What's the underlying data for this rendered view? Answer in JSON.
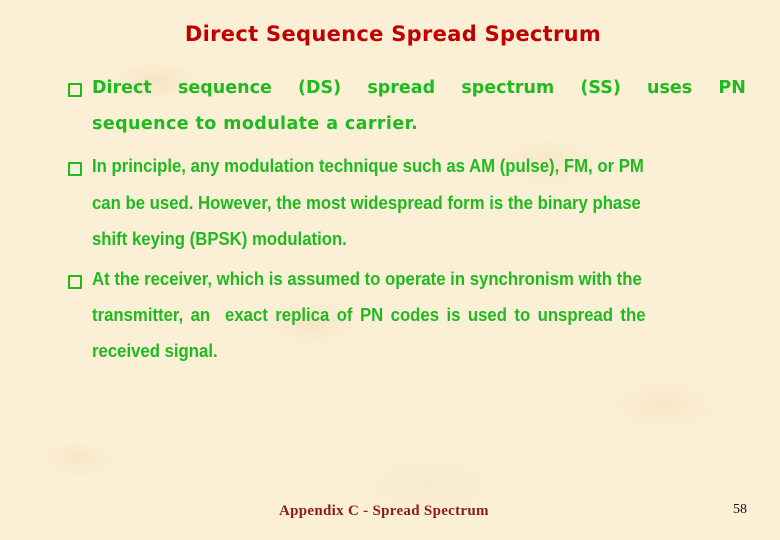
{
  "slide": {
    "title": "Direct Sequence Spread Spectrum",
    "bullets": [
      {
        "icon": "hollow-square-bullet",
        "line1_words": [
          "Direct",
          "sequence",
          "(DS)",
          "spread",
          "spectrum",
          "(SS)",
          "uses",
          "PN"
        ],
        "line2": "sequence to modulate a carrier."
      },
      {
        "icon": "hollow-square-bullet",
        "line1": "In principle, any modulation technique such as AM (pulse), FM, or PM",
        "line2": "can be used. However, the most widespread form is the binary phase",
        "line3": "shift keying (BPSK) modulation."
      },
      {
        "icon": "hollow-square-bullet",
        "line1": "At the receiver, which is assumed to operate in synchronism with the",
        "line2": "transmitter, an  exact replica of PN codes is used to unspread the",
        "line3": "received signal."
      }
    ],
    "footer": "Appendix C - Spread Spectrum",
    "page_number": "58"
  },
  "colors": {
    "title": "#c00000",
    "body_text": "#1fba1f",
    "footer": "#8b1a1a",
    "background": "#fbefd6"
  }
}
